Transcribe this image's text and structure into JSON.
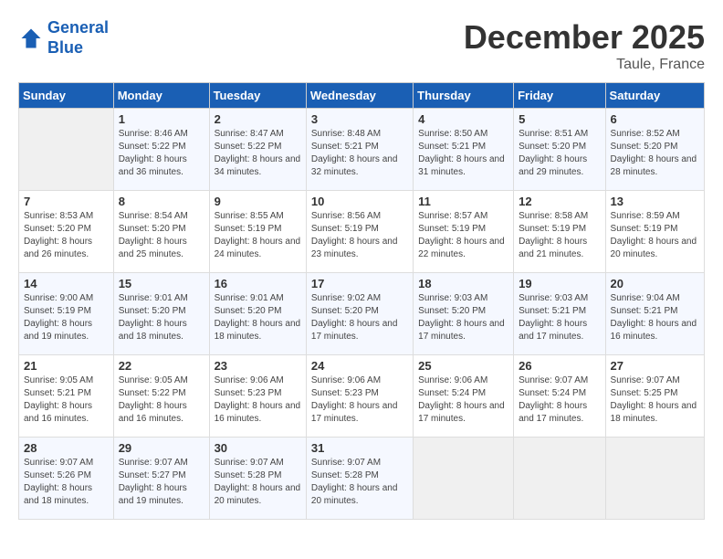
{
  "header": {
    "logo_line1": "General",
    "logo_line2": "Blue",
    "month": "December 2025",
    "location": "Taule, France"
  },
  "weekdays": [
    "Sunday",
    "Monday",
    "Tuesday",
    "Wednesday",
    "Thursday",
    "Friday",
    "Saturday"
  ],
  "weeks": [
    [
      {
        "day": "",
        "sunrise": "",
        "sunset": "",
        "daylight": "",
        "empty": true
      },
      {
        "day": "1",
        "sunrise": "8:46 AM",
        "sunset": "5:22 PM",
        "daylight": "8 hours and 36 minutes."
      },
      {
        "day": "2",
        "sunrise": "8:47 AM",
        "sunset": "5:22 PM",
        "daylight": "8 hours and 34 minutes."
      },
      {
        "day": "3",
        "sunrise": "8:48 AM",
        "sunset": "5:21 PM",
        "daylight": "8 hours and 32 minutes."
      },
      {
        "day": "4",
        "sunrise": "8:50 AM",
        "sunset": "5:21 PM",
        "daylight": "8 hours and 31 minutes."
      },
      {
        "day": "5",
        "sunrise": "8:51 AM",
        "sunset": "5:20 PM",
        "daylight": "8 hours and 29 minutes."
      },
      {
        "day": "6",
        "sunrise": "8:52 AM",
        "sunset": "5:20 PM",
        "daylight": "8 hours and 28 minutes."
      }
    ],
    [
      {
        "day": "7",
        "sunrise": "8:53 AM",
        "sunset": "5:20 PM",
        "daylight": "8 hours and 26 minutes."
      },
      {
        "day": "8",
        "sunrise": "8:54 AM",
        "sunset": "5:20 PM",
        "daylight": "8 hours and 25 minutes."
      },
      {
        "day": "9",
        "sunrise": "8:55 AM",
        "sunset": "5:19 PM",
        "daylight": "8 hours and 24 minutes."
      },
      {
        "day": "10",
        "sunrise": "8:56 AM",
        "sunset": "5:19 PM",
        "daylight": "8 hours and 23 minutes."
      },
      {
        "day": "11",
        "sunrise": "8:57 AM",
        "sunset": "5:19 PM",
        "daylight": "8 hours and 22 minutes."
      },
      {
        "day": "12",
        "sunrise": "8:58 AM",
        "sunset": "5:19 PM",
        "daylight": "8 hours and 21 minutes."
      },
      {
        "day": "13",
        "sunrise": "8:59 AM",
        "sunset": "5:19 PM",
        "daylight": "8 hours and 20 minutes."
      }
    ],
    [
      {
        "day": "14",
        "sunrise": "9:00 AM",
        "sunset": "5:19 PM",
        "daylight": "8 hours and 19 minutes."
      },
      {
        "day": "15",
        "sunrise": "9:01 AM",
        "sunset": "5:20 PM",
        "daylight": "8 hours and 18 minutes."
      },
      {
        "day": "16",
        "sunrise": "9:01 AM",
        "sunset": "5:20 PM",
        "daylight": "8 hours and 18 minutes."
      },
      {
        "day": "17",
        "sunrise": "9:02 AM",
        "sunset": "5:20 PM",
        "daylight": "8 hours and 17 minutes."
      },
      {
        "day": "18",
        "sunrise": "9:03 AM",
        "sunset": "5:20 PM",
        "daylight": "8 hours and 17 minutes."
      },
      {
        "day": "19",
        "sunrise": "9:03 AM",
        "sunset": "5:21 PM",
        "daylight": "8 hours and 17 minutes."
      },
      {
        "day": "20",
        "sunrise": "9:04 AM",
        "sunset": "5:21 PM",
        "daylight": "8 hours and 16 minutes."
      }
    ],
    [
      {
        "day": "21",
        "sunrise": "9:05 AM",
        "sunset": "5:21 PM",
        "daylight": "8 hours and 16 minutes."
      },
      {
        "day": "22",
        "sunrise": "9:05 AM",
        "sunset": "5:22 PM",
        "daylight": "8 hours and 16 minutes."
      },
      {
        "day": "23",
        "sunrise": "9:06 AM",
        "sunset": "5:23 PM",
        "daylight": "8 hours and 16 minutes."
      },
      {
        "day": "24",
        "sunrise": "9:06 AM",
        "sunset": "5:23 PM",
        "daylight": "8 hours and 17 minutes."
      },
      {
        "day": "25",
        "sunrise": "9:06 AM",
        "sunset": "5:24 PM",
        "daylight": "8 hours and 17 minutes."
      },
      {
        "day": "26",
        "sunrise": "9:07 AM",
        "sunset": "5:24 PM",
        "daylight": "8 hours and 17 minutes."
      },
      {
        "day": "27",
        "sunrise": "9:07 AM",
        "sunset": "5:25 PM",
        "daylight": "8 hours and 18 minutes."
      }
    ],
    [
      {
        "day": "28",
        "sunrise": "9:07 AM",
        "sunset": "5:26 PM",
        "daylight": "8 hours and 18 minutes."
      },
      {
        "day": "29",
        "sunrise": "9:07 AM",
        "sunset": "5:27 PM",
        "daylight": "8 hours and 19 minutes."
      },
      {
        "day": "30",
        "sunrise": "9:07 AM",
        "sunset": "5:28 PM",
        "daylight": "8 hours and 20 minutes."
      },
      {
        "day": "31",
        "sunrise": "9:07 AM",
        "sunset": "5:28 PM",
        "daylight": "8 hours and 20 minutes."
      },
      {
        "day": "",
        "sunrise": "",
        "sunset": "",
        "daylight": "",
        "empty": true
      },
      {
        "day": "",
        "sunrise": "",
        "sunset": "",
        "daylight": "",
        "empty": true
      },
      {
        "day": "",
        "sunrise": "",
        "sunset": "",
        "daylight": "",
        "empty": true
      }
    ]
  ]
}
